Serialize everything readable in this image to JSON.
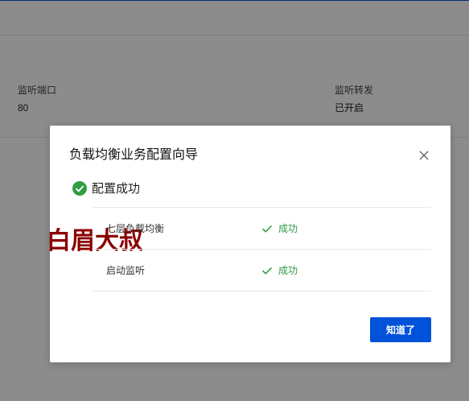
{
  "background": {
    "listener_port": {
      "label": "监听端口",
      "value": "80"
    },
    "listener_forward": {
      "label": "监听转发",
      "value": "已开启"
    }
  },
  "dialog": {
    "title": "负载均衡业务配置向导",
    "summary": "配置成功",
    "watermark": "白眉大叔",
    "steps": [
      {
        "name": "七层负载均衡",
        "status": "成功"
      },
      {
        "name": "启动监听",
        "status": "成功"
      }
    ],
    "confirm_label": "知道了"
  },
  "colors": {
    "accent": "#0052d9",
    "success": "#2e9a44",
    "watermark": "#8b0000"
  },
  "icons": [
    "close-icon",
    "check-icon",
    "success-circle-icon"
  ]
}
